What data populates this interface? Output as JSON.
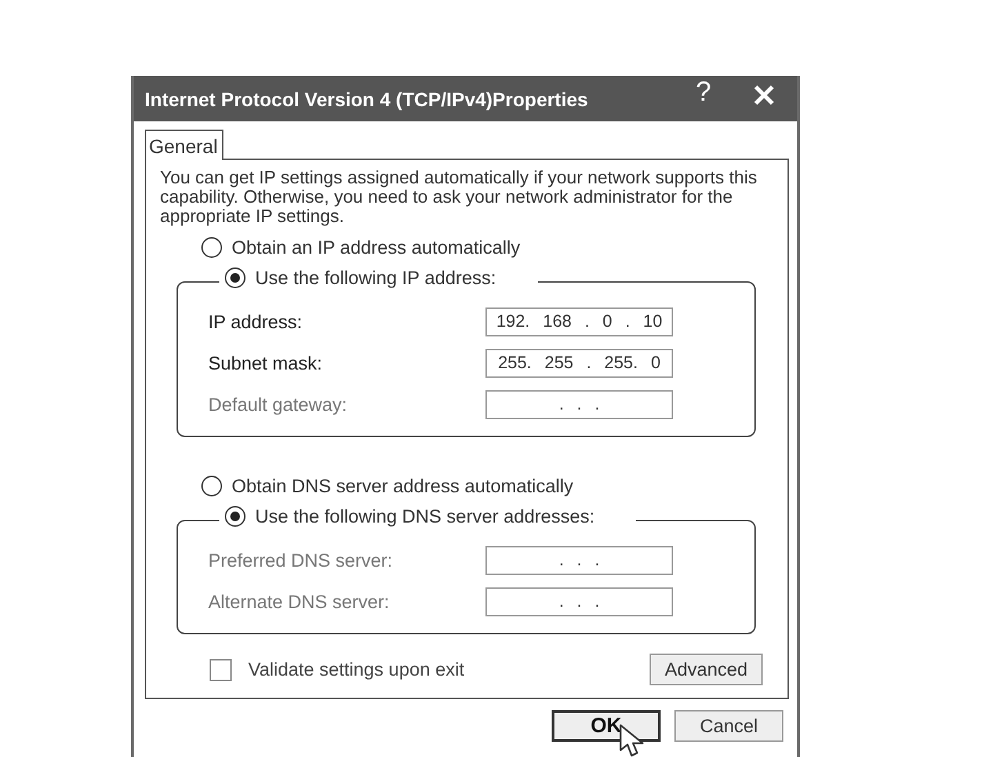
{
  "window": {
    "title": "Internet Protocol Version 4 (TCP/IPv4)Properties",
    "help_button": "?"
  },
  "tabs": [
    {
      "label": "General",
      "selected": true
    }
  ],
  "description": "You can get IP settings assigned automatically if your network supports this capability. Otherwise, you need to ask your network administrator for the appropriate IP settings.",
  "ip_mode": [
    {
      "label": "Obtain an IP address automatically",
      "selected": false
    },
    {
      "label": "Use the following IP address:",
      "selected": true
    }
  ],
  "ip_fields": [
    {
      "label": "IP address:",
      "value": "192. 168 . 0 . 10",
      "disabled": false
    },
    {
      "label": "Subnet mask:",
      "value": "255. 255 . 255. 0",
      "disabled": false
    },
    {
      "label": "Default gateway:",
      "value": ". . .",
      "disabled": true
    }
  ],
  "dns_mode": [
    {
      "label": "Obtain DNS  server address automatically",
      "selected": false
    },
    {
      "label": "Use the following DNS server addresses:",
      "selected": true
    }
  ],
  "dns_fields": [
    {
      "label": "Preferred DNS server:",
      "value": ". . .",
      "disabled": true
    },
    {
      "label": "Alternate DNS server:",
      "value": ". . .",
      "disabled": true
    }
  ],
  "validate": {
    "label": "Validate settings upon exit",
    "checked": false
  },
  "advanced_button": "Advanced",
  "buttons": [
    {
      "label": "OK",
      "default": true
    },
    {
      "label": "Cancel",
      "default": false
    }
  ]
}
